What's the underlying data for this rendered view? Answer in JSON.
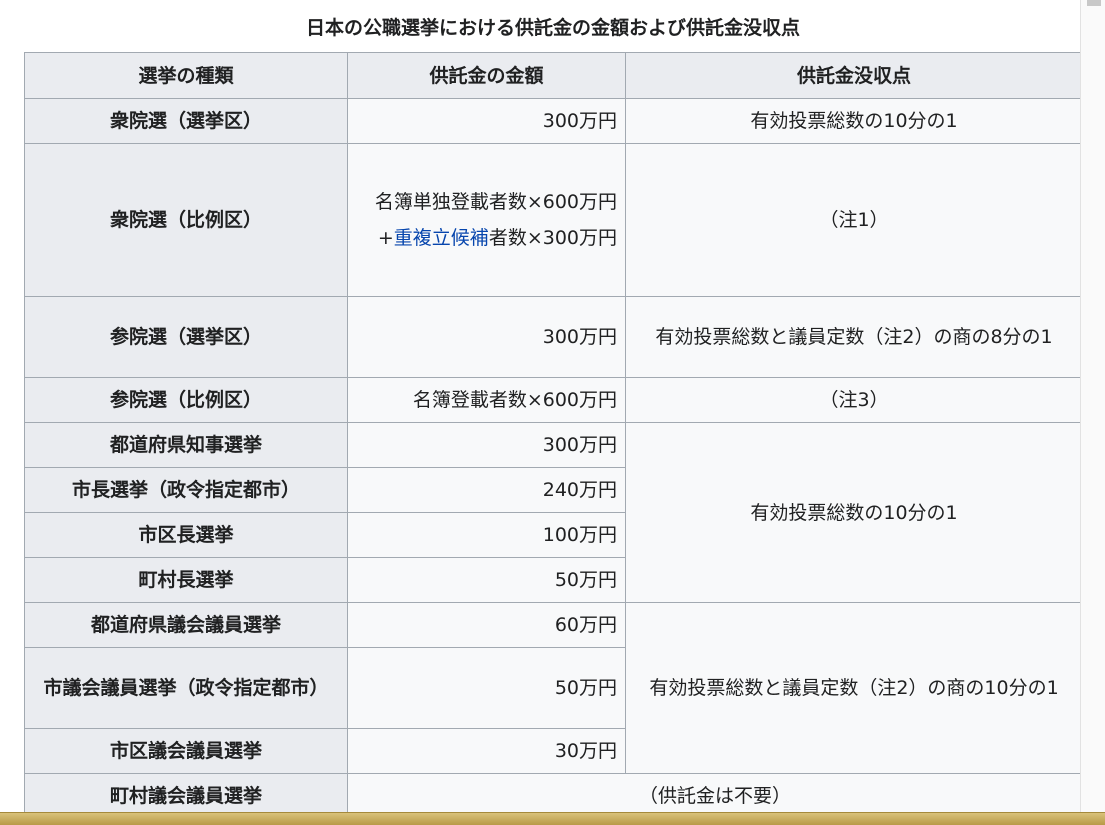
{
  "caption": "日本の公職選挙における供託金の金額および供託金没収点",
  "headers": {
    "type": "選挙の種類",
    "amount": "供託金の金額",
    "forfeit": "供託金没収点"
  },
  "rows": [
    {
      "type": "衆院選（選挙区）",
      "amount": "300万円",
      "forfeit": "有効投票総数の10分の1"
    },
    {
      "type": "衆院選（比例区）",
      "amount_line1": "名簿単独登載者数×600万円",
      "amount_plus": "+",
      "amount_link": "重複立候補",
      "amount_line2_rest": "者数×300万円",
      "forfeit": "（注1）"
    },
    {
      "type": "参院選（選挙区）",
      "amount": "300万円",
      "forfeit": "有効投票総数と議員定数（注2）の商の8分の1"
    },
    {
      "type": "参院選（比例区）",
      "amount": "名簿登載者数×600万円",
      "forfeit": "（注3）"
    },
    {
      "type": "都道府県知事選挙",
      "amount": "300万円",
      "forfeit": "有効投票総数の10分の1"
    },
    {
      "type": "市長選挙（政令指定都市）",
      "amount": "240万円"
    },
    {
      "type": "市区長選挙",
      "amount": "100万円"
    },
    {
      "type": "町村長選挙",
      "amount": "50万円"
    },
    {
      "type": "都道府県議会議員選挙",
      "amount": "60万円",
      "forfeit": "有効投票総数と議員定数（注2）の商の10分の1"
    },
    {
      "type": "市議会議員選挙（政令指定都市）",
      "amount": "50万円"
    },
    {
      "type": "市区議会議員選挙",
      "amount": "30万円"
    },
    {
      "type": "町村議会議員選挙",
      "span": "（供託金は不要）"
    }
  ]
}
